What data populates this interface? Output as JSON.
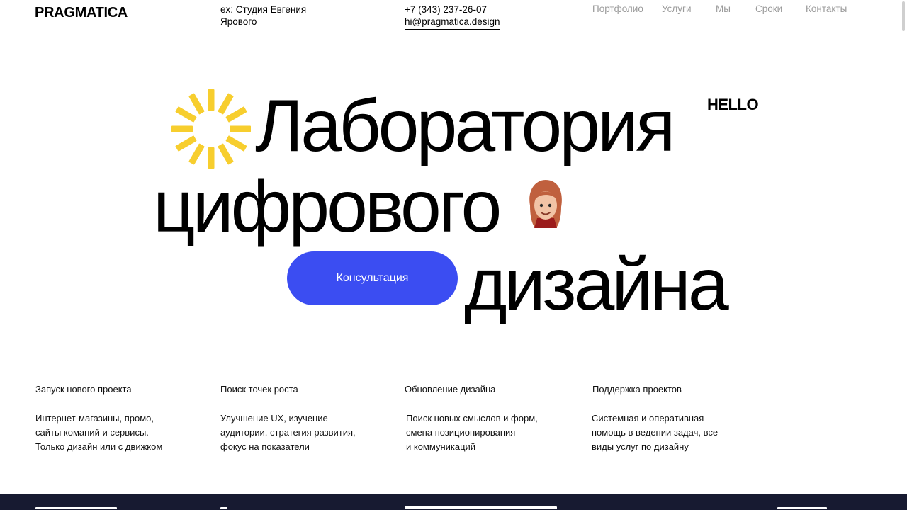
{
  "header": {
    "logo": "PRAGMATICA",
    "ex_line1": "ex: Студия Евгения",
    "ex_line2": "Ярового",
    "phone": "+7 (343) 237-26-07",
    "email": "hi@pragmatica.design",
    "nav": [
      "Портфолио",
      "Услуги",
      "Мы",
      "Сроки",
      "Контакты"
    ]
  },
  "hero": {
    "line1": "Лаборатория",
    "line2": "цифрового",
    "line3": "дизайна",
    "hello": "HELLO",
    "cta": "Консультация",
    "sun_color": "#f7ce2e",
    "cta_color": "#3b4df2"
  },
  "features": [
    {
      "title": "Запуск нового проекта",
      "line1": "Интернет-магазины, промо,",
      "line2": "сайты команий и сервисы.",
      "line3": "Только дизайн или с движком"
    },
    {
      "title": "Поиск точек роста",
      "line1": "Улучшение UX, изучение",
      "line2": "аудитории, стратегия развития,",
      "line3": "фокус на показатели"
    },
    {
      "title": "Обновление дизайна",
      "line1": "Поиск новых смыслов и форм,",
      "line2": "смена позиционирования",
      "line3": "и коммуникаций"
    },
    {
      "title": "Поддержка проектов",
      "line1": "Системная и оперативная",
      "line2": "помощь в ведении задач, все",
      "line3": "виды услуг по дизайну"
    }
  ],
  "footer": {
    "background": "#171a31"
  }
}
